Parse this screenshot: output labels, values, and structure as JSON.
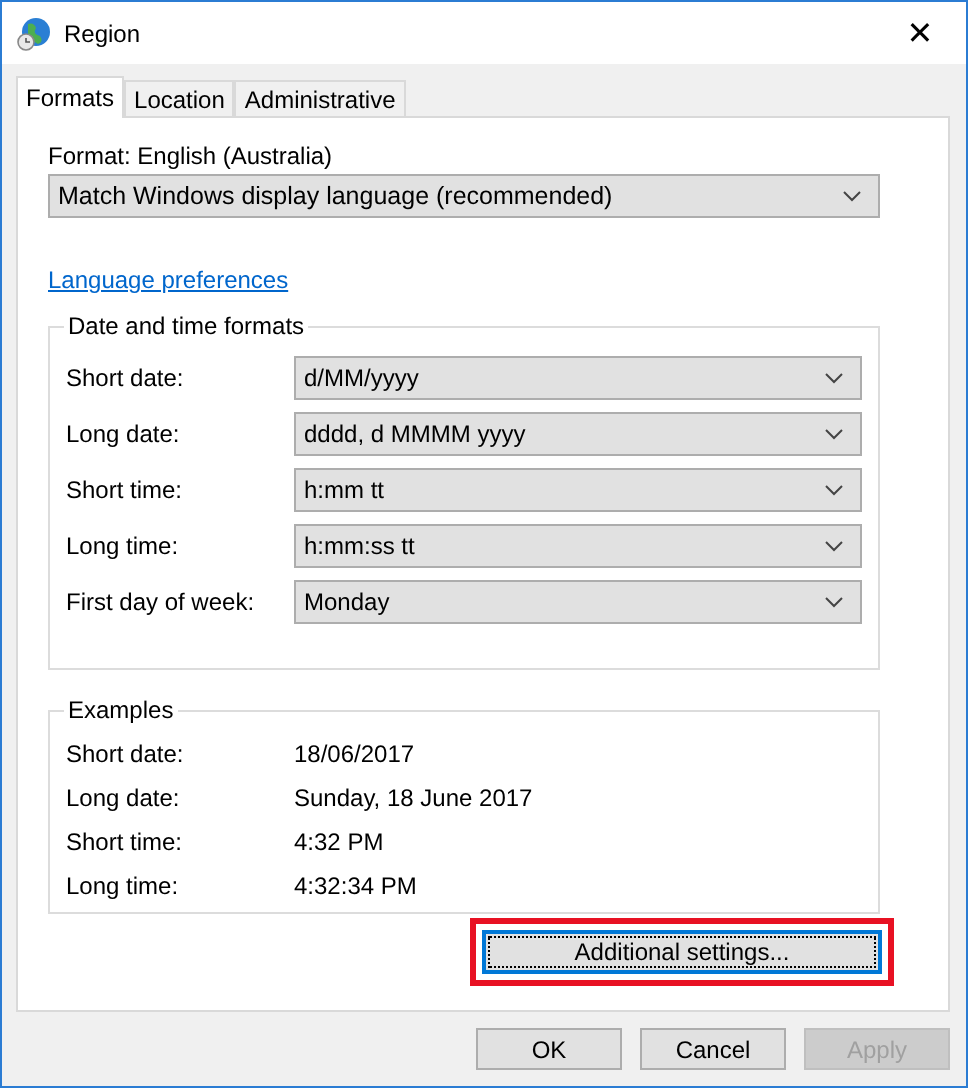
{
  "window": {
    "title": "Region",
    "close": "✕"
  },
  "tabs": [
    {
      "label": "Formats",
      "selected": true
    },
    {
      "label": "Location",
      "selected": false
    },
    {
      "label": "Administrative",
      "selected": false
    }
  ],
  "format": {
    "label": "Format: English (Australia)",
    "value": "Match Windows display language (recommended)"
  },
  "language_link": "Language preferences",
  "date_time_formats": {
    "title": "Date and time formats",
    "rows": [
      {
        "label": "Short date:",
        "value": "d/MM/yyyy"
      },
      {
        "label": "Long date:",
        "value": "dddd, d MMMM yyyy"
      },
      {
        "label": "Short time:",
        "value": "h:mm tt"
      },
      {
        "label": "Long time:",
        "value": "h:mm:ss tt"
      },
      {
        "label": "First day of week:",
        "value": "Monday"
      }
    ]
  },
  "examples": {
    "title": "Examples",
    "rows": [
      {
        "label": "Short date:",
        "value": "18/06/2017"
      },
      {
        "label": "Long date:",
        "value": "Sunday, 18 June 2017"
      },
      {
        "label": "Short time:",
        "value": "4:32 PM"
      },
      {
        "label": "Long time:",
        "value": "4:32:34 PM"
      }
    ]
  },
  "additional_settings": {
    "label": "Additional settings...",
    "highlighted": true
  },
  "buttons": [
    {
      "label": "OK",
      "disabled": false
    },
    {
      "label": "Cancel",
      "disabled": false
    },
    {
      "label": "Apply",
      "disabled": true
    }
  ]
}
